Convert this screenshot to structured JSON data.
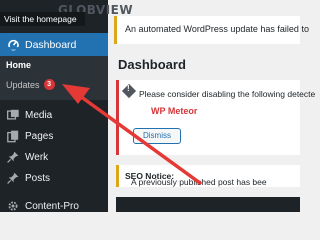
{
  "brand": {
    "logo_text": "GLOBVIEW"
  },
  "tooltip": "Visit the homepage",
  "sidebar": {
    "dashboard_label": "Dashboard",
    "submenu": {
      "home": "Home",
      "updates": "Updates",
      "updates_badge": "3"
    },
    "items": [
      {
        "label": "Media",
        "icon": "media-icon"
      },
      {
        "label": "Pages",
        "icon": "pages-icon"
      },
      {
        "label": "Werk",
        "icon": "pin-icon"
      },
      {
        "label": "Posts",
        "icon": "pin-icon"
      },
      {
        "label": "Content-Pro",
        "icon": "gear-icon"
      }
    ]
  },
  "notices": {
    "update": "An automated WordPress update has failed to",
    "plugin": {
      "text": "Please consider disabling the following detecte",
      "plugin_name": "WP Meteor",
      "dismiss_label": "Dismiss"
    },
    "seo": {
      "label": "SEO Notice:",
      "text": " A previously published post has bee"
    }
  },
  "page_title": "Dashboard",
  "colors": {
    "sidebar_bg": "#1d2327",
    "accent_blue": "#2271b1",
    "warning": "#dba617",
    "error": "#d63638",
    "annotation_arrow": "#e53935"
  }
}
